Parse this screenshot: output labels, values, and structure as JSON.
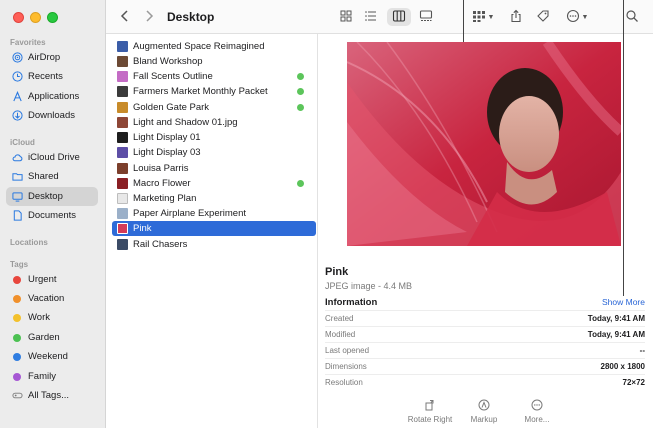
{
  "window": {
    "title": "Desktop"
  },
  "sidebar": {
    "sections": {
      "favorites": "Favorites",
      "icloud": "iCloud",
      "locations": "Locations",
      "tags": "Tags"
    },
    "favorites": [
      {
        "label": "AirDrop",
        "icon": "airdrop-icon"
      },
      {
        "label": "Recents",
        "icon": "clock-icon"
      },
      {
        "label": "Applications",
        "icon": "applications-icon"
      },
      {
        "label": "Downloads",
        "icon": "download-icon"
      }
    ],
    "icloud": [
      {
        "label": "iCloud Drive",
        "icon": "cloud-icon"
      },
      {
        "label": "Shared",
        "icon": "shared-folder-icon"
      },
      {
        "label": "Desktop",
        "icon": "desktop-icon",
        "selected": true
      },
      {
        "label": "Documents",
        "icon": "document-icon"
      }
    ],
    "tags": [
      {
        "label": "Urgent",
        "color": "#e8463d"
      },
      {
        "label": "Vacation",
        "color": "#f0902b"
      },
      {
        "label": "Work",
        "color": "#f3c12d"
      },
      {
        "label": "Garden",
        "color": "#4cc152"
      },
      {
        "label": "Weekend",
        "color": "#2f7de1"
      },
      {
        "label": "Family",
        "color": "#a657d4"
      },
      {
        "label": "All Tags...",
        "color": ""
      }
    ]
  },
  "toolbar": {
    "back_icon": "chevron-left-icon",
    "forward_icon": "chevron-right-icon",
    "views": [
      "icon-view",
      "list-view",
      "column-view",
      "gallery-view"
    ],
    "active_view": "column-view"
  },
  "files": [
    {
      "name": "Augmented Space Reimagined",
      "color": "#3b5da8",
      "tag": false
    },
    {
      "name": "Bland Workshop",
      "color": "#6c4a35",
      "tag": false
    },
    {
      "name": "Fall Scents Outline",
      "color": "#c46cc5",
      "tag": true
    },
    {
      "name": "Farmers Market Monthly Packet",
      "color": "#3b3b3b",
      "tag": true
    },
    {
      "name": "Golden Gate Park",
      "color": "#c88b2a",
      "tag": true
    },
    {
      "name": "Light and Shadow 01.jpg",
      "color": "#8e4636",
      "tag": false
    },
    {
      "name": "Light Display 01",
      "color": "#1e1e1e",
      "tag": false
    },
    {
      "name": "Light Display 03",
      "color": "#5d4ea6",
      "tag": false
    },
    {
      "name": "Louisa Parris",
      "color": "#7c3f2c",
      "tag": false
    },
    {
      "name": "Macro Flower",
      "color": "#8a1f24",
      "tag": true
    },
    {
      "name": "Marketing Plan",
      "color": "#e8e8e8",
      "tag": false
    },
    {
      "name": "Paper Airplane Experiment",
      "color": "#9bb0c9",
      "tag": false
    },
    {
      "name": "Pink",
      "color": "#d43a58",
      "tag": false,
      "selected": true
    },
    {
      "name": "Rail Chasers",
      "color": "#3b4b66",
      "tag": false
    }
  ],
  "preview": {
    "name": "Pink",
    "subtitle": "JPEG image - 4.4 MB",
    "info_title": "Information",
    "show_more": "Show More",
    "rows": [
      {
        "key": "Created",
        "value": "Today, 9:41 AM"
      },
      {
        "key": "Modified",
        "value": "Today, 9:41 AM"
      },
      {
        "key": "Last opened",
        "value": "--"
      },
      {
        "key": "Dimensions",
        "value": "2800 x 1800"
      },
      {
        "key": "Resolution",
        "value": "72×72"
      }
    ],
    "actions": [
      {
        "label": "Rotate Right",
        "icon": "rotate-right-icon"
      },
      {
        "label": "Markup",
        "icon": "markup-icon"
      },
      {
        "label": "More...",
        "icon": "more-icon"
      }
    ]
  }
}
